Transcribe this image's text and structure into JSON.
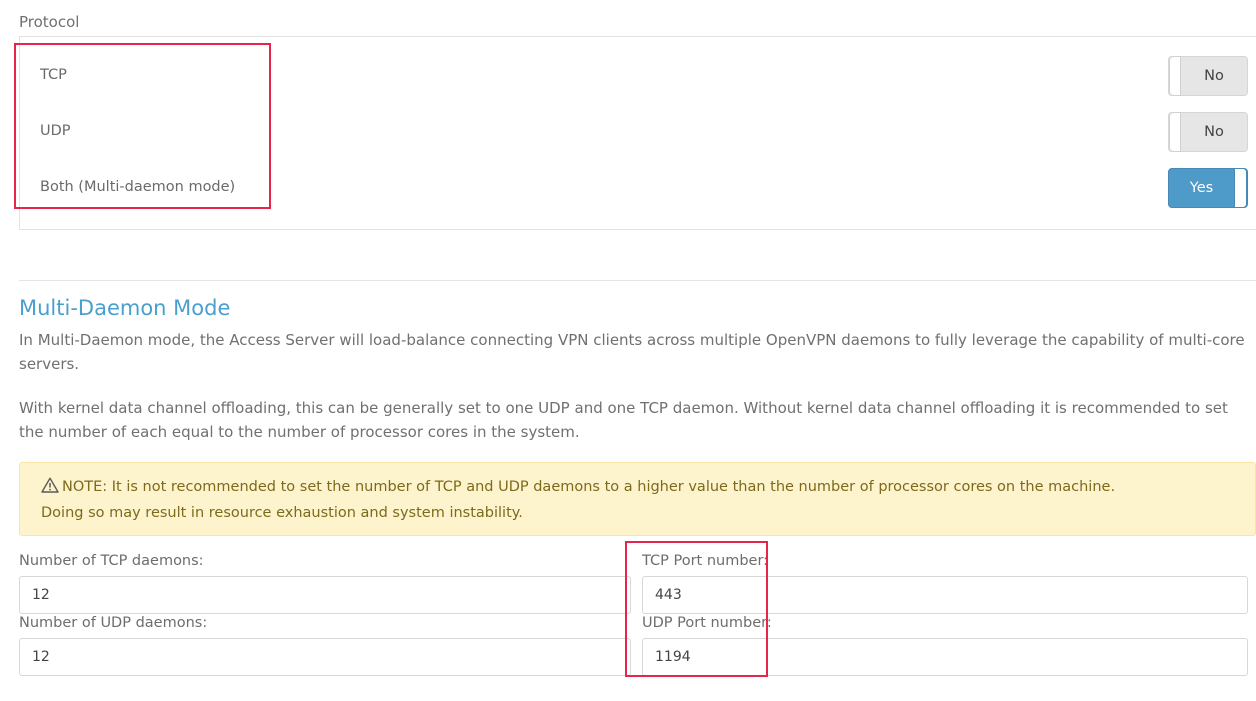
{
  "protocol": {
    "label": "Protocol",
    "options": [
      {
        "label": "TCP",
        "toggle": "No",
        "state": false
      },
      {
        "label": "UDP",
        "toggle": "No",
        "state": false
      },
      {
        "label": "Both (Multi-daemon mode)",
        "toggle": "Yes",
        "state": true
      }
    ]
  },
  "multi_daemon": {
    "title": "Multi-Daemon Mode",
    "description_1": "In Multi-Daemon mode, the Access Server will load-balance connecting VPN clients across multiple OpenVPN daemons to fully leverage the capability of multi-core servers.",
    "description_2": "With kernel data channel offloading, this can be generally set to one UDP and one TCP daemon. Without kernel data channel offloading it is recommended to set the number of each equal to the number of processor cores in the system.",
    "note": "NOTE: It is not recommended to set the number of TCP and UDP daemons to a higher value than the number of processor cores on the machine. Doing so may result in resource exhaustion and system instability.",
    "note_icon": "warning-triangle-icon"
  },
  "fields": {
    "tcp_daemons": {
      "label": "Number of TCP daemons:",
      "value": "12"
    },
    "tcp_port": {
      "label": "TCP Port number:",
      "value": "443"
    },
    "udp_daemons": {
      "label": "Number of UDP daemons:",
      "value": "12"
    },
    "udp_port": {
      "label": "UDP Port number:",
      "value": "1194"
    }
  },
  "colors": {
    "accent": "#4a9fcf",
    "toggle_on": "#4e9ac9",
    "highlight": "#e4254c",
    "note_bg": "#fdf3cd"
  }
}
